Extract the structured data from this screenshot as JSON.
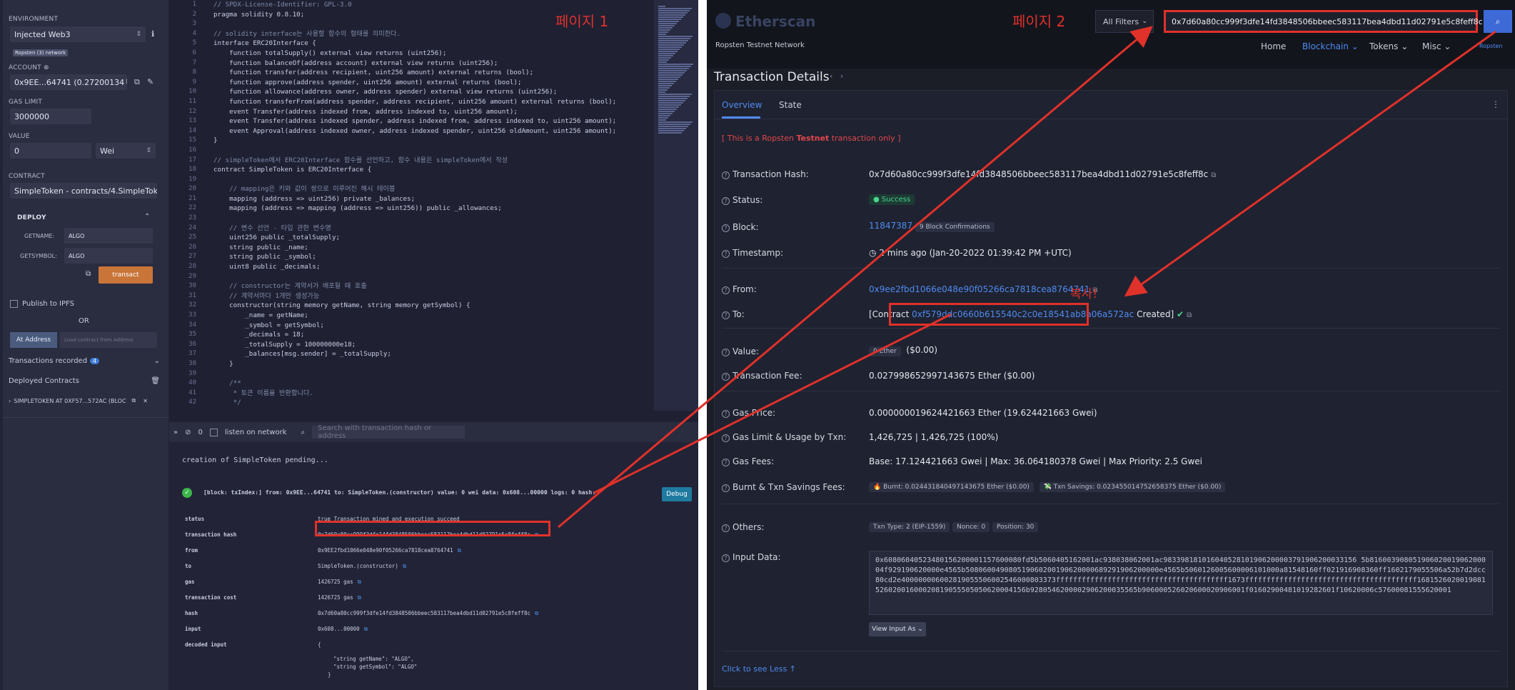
{
  "remix": {
    "environment_label": "ENVIRONMENT",
    "environment_value": "Injected Web3",
    "network_badge": "Ropsten (3) network",
    "account_label": "ACCOUNT",
    "account_value": "0x9EE...64741 (0.27200134",
    "gas_limit_label": "GAS LIMIT",
    "gas_limit_value": "3000000",
    "value_label": "VALUE",
    "value_amount": "0",
    "value_unit": "Wei",
    "contract_label": "CONTRACT",
    "contract_value": "SimpleToken - contracts/4.SimpleToke",
    "deploy_label": "DEPLOY",
    "getname_label": "GETNAME:",
    "getname_value": "ALGO",
    "getsymbol_label": "GETSYMBOL:",
    "getsymbol_value": "ALGO",
    "transact_label": "transact",
    "publish_label": "Publish to IPFS",
    "or_label": "OR",
    "at_address_label": "At Address",
    "load_contract_placeholder": "Load contract from Address",
    "tx_recorded_label": "Transactions recorded",
    "tx_recorded_count": "4",
    "deployed_label": "Deployed Contracts",
    "deployed_item": "SIMPLETOKEN AT 0XF57...572AC (BLOC",
    "page_tag": "페이지 1",
    "line_numbers": [
      "1",
      "2",
      "3",
      "4",
      "5",
      "6",
      "7",
      "8",
      "9",
      "10",
      "11",
      "12",
      "13",
      "14",
      "15",
      "16",
      "17",
      "18",
      "19",
      "20",
      "21",
      "22",
      "23",
      "24",
      "25",
      "26",
      "27",
      "28",
      "29",
      "30",
      "31",
      "32",
      "33",
      "34",
      "35",
      "36",
      "37",
      "38",
      "39",
      "40",
      "41",
      "42"
    ],
    "code_lines": [
      "// SPDX-License-Identifier: GPL-3.0",
      "pragma solidity 0.8.10;",
      "",
      "// solidity interface는 사용할 함수의 형태를 의미한다.",
      "interface ERC20Interface {",
      "    function totalSupply() external view returns (uint256);",
      "    function balanceOf(address account) external view returns (uint256);",
      "    function transfer(address recipient, uint256 amount) external returns (bool);",
      "    function approve(address spender, uint256 amount) external returns (bool);",
      "    function allowance(address owner, address spender) external view returns (uint256);",
      "    function transferFrom(address spender, address recipient, uint256 amount) external returns (bool);",
      "    event Transfer(address indexed from, address indexed to, uint256 amount);",
      "    event Transfer(address indexed spender, address indexed from, address indexed to, uint256 amount);",
      "    event Approval(address indexed owner, address indexed spender, uint256 oldAmount, uint256 amount);",
      "}",
      "",
      "// simpleToken에서 ERC20Interface 함수를 선언하고, 함수 내용은 simpleToken에서 작성",
      "contract SimpleToken is ERC20Interface {",
      "",
      "    // mapping은 키와 값이 쌍으로 이루어진 해시 테이블",
      "    mapping (address => uint256) private _balances;",
      "    mapping (address => mapping (address => uint256)) public _allowances;",
      "",
      "    // 변수 선언 - 타입 관한 변수명",
      "    uint256 public _totalSupply;",
      "    string public _name;",
      "    string public _symbol;",
      "    uint8 public _decimals;",
      "",
      "    // constructor는 계약서가 배포될 때 호출",
      "    // 계약서마다 1개만 생성가능",
      "    constructor(string memory getName, string memory getSymbol) {",
      "        _name = getName;",
      "        _symbol = getSymbol;",
      "        _decimals = 18;",
      "        _totalSupply = 100000000e18;",
      "        _balances[msg.sender] = _totalSupply;",
      "    }",
      "",
      "    /**",
      "     * 토큰 이름을 반환합니다.",
      "     */"
    ],
    "console": {
      "count": "0",
      "listen_label": "listen on network",
      "search_placeholder": "Search with transaction hash or address",
      "pending": "creation of SimpleToken pending...",
      "summary": "[block: txIndex:] from: 0x9EE...64741 to: SimpleToken.(constructor) value: 0 wei data: 0x608...00000 logs: 0 hash:",
      "debug_label": "Debug",
      "rows": [
        {
          "k": "status",
          "v": "true Transaction mined and execution succeed",
          "copy": false
        },
        {
          "k": "transaction hash",
          "v": "0x7d60a80cc999f3dfe14fd3848506bbeec583117bea4dbd11d02791e5c8feff8c",
          "copy": true
        },
        {
          "k": "from",
          "v": "0x9EE2fbd1066e048e90f05266ca7818cea8764741",
          "copy": true
        },
        {
          "k": "to",
          "v": "SimpleToken.(constructor)",
          "copy": true
        },
        {
          "k": "gas",
          "v": "1426725 gas",
          "copy": true
        },
        {
          "k": "transaction cost",
          "v": "1426725 gas",
          "copy": true
        },
        {
          "k": "hash",
          "v": "0x7d60a80cc999f3dfe14fd3848506bbeec583117bea4dbd11d02791e5c8feff8c",
          "copy": true
        },
        {
          "k": "input",
          "v": "0x608...00000",
          "copy": true
        },
        {
          "k": "decoded input",
          "v": "{",
          "copy": false
        }
      ],
      "decoded_lines": [
        "\"string getName\": \"ALGO\",",
        "\"string getSymbol\": \"ALGO\"",
        "}"
      ]
    }
  },
  "eth": {
    "logo": "Etherscan",
    "network": "Ropsten Testnet Network",
    "page_tag": "페이지 2",
    "filter_label": "All Filters",
    "search_value": "0x7d60a80cc999f3dfe14fd3848506bbeec583117bea4dbd11d02791e5c8feff8c",
    "nav": [
      "Home",
      "Blockchain",
      "Tokens",
      "Misc"
    ],
    "ropsten_small": "Ropsten",
    "title": "Transaction Details",
    "tabs": [
      "Overview",
      "State"
    ],
    "warning_pre": "[ This is a Ropsten ",
    "warning_bold": "Testnet",
    "warning_post": " transaction only ]",
    "copy_tag": "복사!",
    "rows": {
      "hash_label": "Transaction Hash:",
      "hash_value": "0x7d60a80cc999f3dfe14fd3848506bbeec583117bea4dbd11d02791e5c8feff8c",
      "status_label": "Status:",
      "status_value": "Success",
      "block_label": "Block:",
      "block_value": "11847387",
      "block_conf": "9 Block Confirmations",
      "timestamp_label": "Timestamp:",
      "timestamp_value": "2 mins ago (Jan-20-2022 01:39:42 PM +UTC)",
      "from_label": "From:",
      "from_value": "0x9ee2fbd1066e048e90f05266ca7818cea8764741",
      "to_label": "To:",
      "to_pre": "[Contract ",
      "to_value": "0xf579ddc0660b615540c2c0e18541ab8a06a572ac",
      "to_post": " Created]",
      "value_label": "Value:",
      "value_pill": "0 Ether",
      "value_usd": "($0.00)",
      "fee_label": "Transaction Fee:",
      "fee_value": "0.027998652997143675 Ether ($0.00)",
      "gas_price_label": "Gas Price:",
      "gas_price_value": "0.000000019624421663 Ether (19.624421663 Gwei)",
      "gas_limit_label": "Gas Limit & Usage by Txn:",
      "gas_limit_value": "1,426,725   |   1,426,725 (100%)",
      "gas_fees_label": "Gas Fees:",
      "gas_fees_value": "Base: 17.124421663 Gwei   |   Max: 36.064180378 Gwei   |   Max Priority: 2.5 Gwei",
      "burnt_label": "Burnt & Txn Savings Fees:",
      "burnt_value": "🔥 Burnt: 0.024431840497143675 Ether ($0.00)",
      "savings_value": "💸 Txn Savings: 0.023455014752658375 Ether ($0.00)",
      "others_label": "Others:",
      "others_type": "Txn Type: 2 (EIP-1559)",
      "others_nonce": "Nonce: 0",
      "others_pos": "Position: 30",
      "input_label": "Input Data:",
      "input_value": "0x60806040523480156200001157600080fd5b5060405162001ac938038062001ac983398181016040528101906200003791906200033156 5b81600390805190602001906200004f929190620000e4565b508060049080519060200190620000689291906200000e4565b5060126005600006101000a81548160ff021916908360ff1602179055506a52b7d2dcc80cd2e400000006002819055506002546000803373ffffffffffffffffffffffffffffffffffffffff1673ffffffffffffffffffffffffffffffffffffffff168152602001908152602001600020819055505050620004156b9280546200002906200035565b906000526020600020906001f01602900481019282601f10620006c57600081555620001",
      "view_input": "View Input As",
      "see_less": "Click to see Less"
    }
  },
  "colors": {
    "annotation_red": "#e0312a",
    "link_blue": "#4f8bf0"
  }
}
